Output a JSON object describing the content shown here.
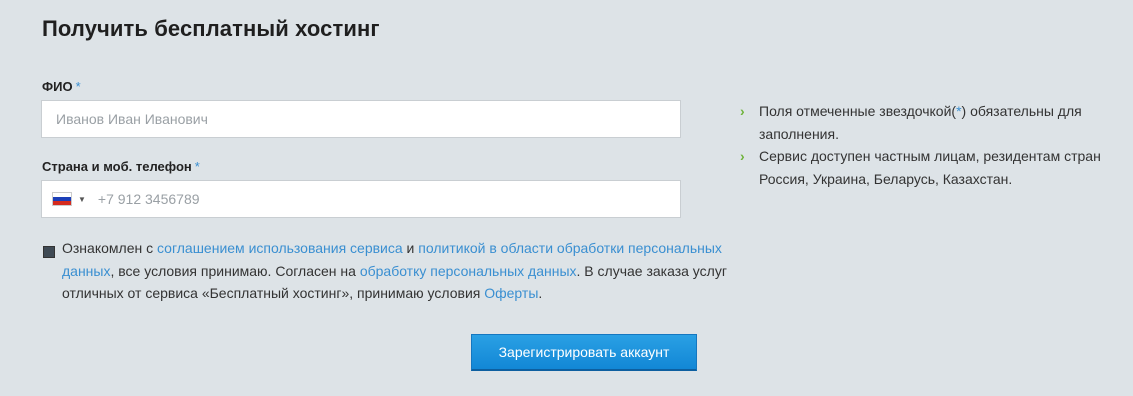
{
  "form": {
    "title": "Получить бесплатный хостинг",
    "fio": {
      "label": "ФИО",
      "required_mark": "*",
      "value": "",
      "placeholder": "Иванов Иван Иванович"
    },
    "phone": {
      "label": "Страна и моб. телефон",
      "required_mark": "*",
      "country_flag": "russia-flag",
      "value": "",
      "placeholder": "+7 912 3456789"
    },
    "agreement": {
      "checked": true,
      "text_1": "Ознакомлен с ",
      "link_1": "соглашением использования сервиса",
      "text_2": " и ",
      "link_2": "политикой в области обработки персональных данных",
      "text_3": ", все условия принимаю. Согласен на ",
      "link_3": "обработку персональных данных",
      "text_4": ". В случае заказа услуг отличных от сервиса «Бесплатный хостинг», принимаю условия ",
      "link_4": "Оферты",
      "text_5": "."
    },
    "submit_label": "Зарегистрировать аккаунт"
  },
  "notes": [
    {
      "text_before": "Поля отмеченные звездочкой(",
      "star": "*",
      "text_after": ") обязательны для заполнения."
    },
    {
      "text": "Сервис доступен частным лицам, резидентам стран Россия, Украина, Беларусь, Казахстан."
    }
  ],
  "colors": {
    "background": "#dde3e7",
    "link": "#3a8fd1",
    "bullet_arrow": "#6fb33b",
    "button": "#1a8fdb"
  }
}
